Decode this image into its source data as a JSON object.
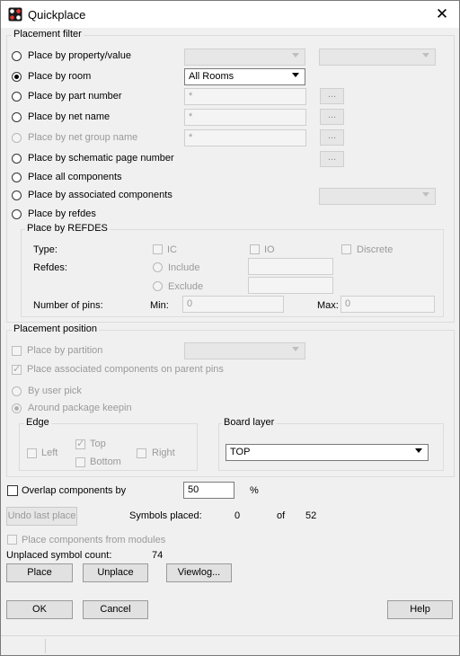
{
  "window": {
    "title": "Quickplace",
    "icon": "quickplace-app-icon",
    "close_icon": "close-icon",
    "close_glyph": "✕"
  },
  "placement_filter": {
    "legend": "Placement filter",
    "options": [
      {
        "label": "Place by property/value",
        "selected": false,
        "enabled": true
      },
      {
        "label": "Place by room",
        "selected": true,
        "enabled": true
      },
      {
        "label": "Place by part number",
        "selected": false,
        "enabled": true
      },
      {
        "label": "Place by net name",
        "selected": false,
        "enabled": true
      },
      {
        "label": "Place by net group name",
        "selected": false,
        "enabled": false
      },
      {
        "label": "Place by schematic page number",
        "selected": false,
        "enabled": true
      },
      {
        "label": "Place all components",
        "selected": false,
        "enabled": true
      },
      {
        "label": "Place by associated components",
        "selected": false,
        "enabled": true
      },
      {
        "label": "Place by refdes",
        "selected": false,
        "enabled": true
      }
    ],
    "room_value": "All Rooms",
    "part_number_value": "*",
    "net_name_value": "*",
    "net_group_value": "*",
    "browse_label": "...",
    "refdes_group": {
      "legend": "Place by REFDES",
      "type_label": "Type:",
      "type_ic": "IC",
      "type_io": "IO",
      "type_discrete": "Discrete",
      "refdes_label": "Refdes:",
      "include": "Include",
      "exclude": "Exclude",
      "pins_label": "Number of pins:",
      "min_label": "Min:",
      "min_value": "0",
      "max_label": "Max:",
      "max_value": "0"
    }
  },
  "placement_position": {
    "legend": "Placement position",
    "by_partition": "Place by partition",
    "assoc_parent": "Place associated components on parent pins",
    "by_user_pick": "By user pick",
    "around_keepin": "Around package keepin",
    "edge": {
      "legend": "Edge",
      "left": "Left",
      "top": "Top",
      "right": "Right",
      "bottom": "Bottom"
    },
    "board_layer": {
      "legend": "Board layer",
      "value": "TOP"
    }
  },
  "overlap": {
    "label": "Overlap components by",
    "value": "50",
    "unit": "%"
  },
  "undo_last_place": "Undo last place",
  "symbols_placed": {
    "label": "Symbols placed:",
    "placed": "0",
    "of": "of",
    "total": "52"
  },
  "place_from_modules": "Place components from modules",
  "unplaced": {
    "label": "Unplaced symbol count:",
    "value": "74"
  },
  "actions": {
    "place": "Place",
    "unplace": "Unplace",
    "viewlog": "Viewlog..."
  },
  "dialog": {
    "ok": "OK",
    "cancel": "Cancel",
    "help": "Help"
  }
}
